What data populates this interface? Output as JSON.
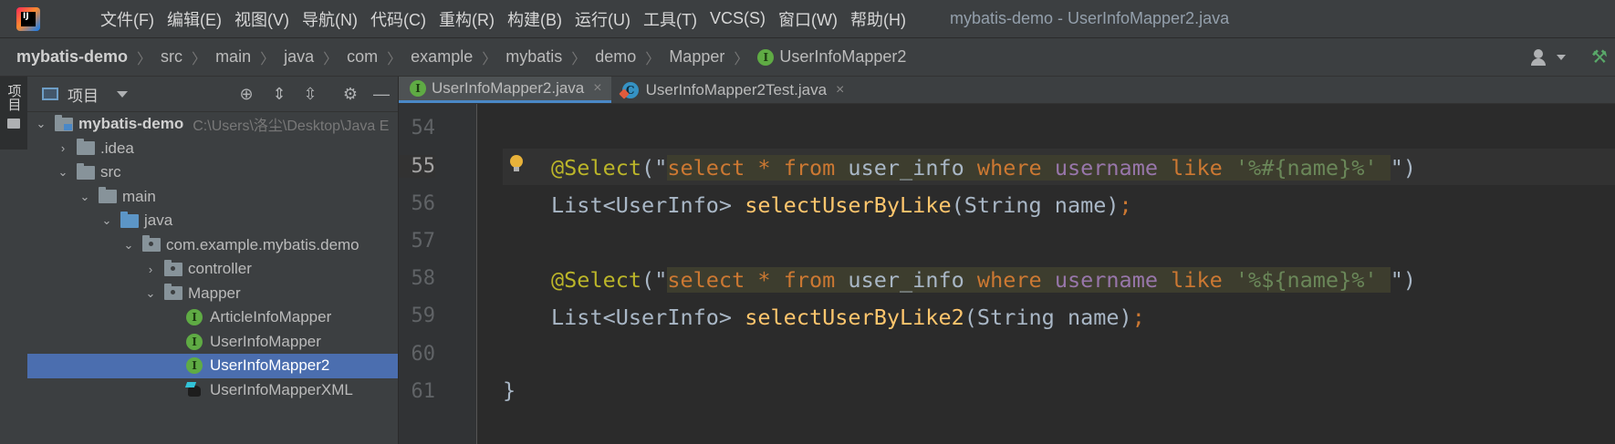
{
  "menu": {
    "items": [
      "文件(F)",
      "编辑(E)",
      "视图(V)",
      "导航(N)",
      "代码(C)",
      "重构(R)",
      "构建(B)",
      "运行(U)",
      "工具(T)",
      "VCS(S)",
      "窗口(W)",
      "帮助(H)"
    ],
    "window_title": "mybatis-demo - UserInfoMapper2.java"
  },
  "breadcrumb": [
    "mybatis-demo",
    "src",
    "main",
    "java",
    "com",
    "example",
    "mybatis",
    "demo",
    "Mapper",
    "UserInfoMapper2"
  ],
  "tool_strip": {
    "project_label": "项目"
  },
  "project_panel": {
    "title": "项目",
    "tree": [
      {
        "label": "mybatis-demo",
        "hint": "C:\\Users\\洛尘\\Desktop\\Java E",
        "icon": "project-folder-icon",
        "level": 0,
        "expanded": true
      },
      {
        "label": ".idea",
        "icon": "folder-icon",
        "level": 1,
        "expanded": false
      },
      {
        "label": "src",
        "icon": "folder-icon",
        "level": 1,
        "expanded": true
      },
      {
        "label": "main",
        "icon": "folder-icon",
        "level": 2,
        "expanded": true
      },
      {
        "label": "java",
        "icon": "source-folder-icon",
        "level": 3,
        "expanded": true
      },
      {
        "label": "com.example.mybatis.demo",
        "icon": "package-icon",
        "level": 4,
        "expanded": true
      },
      {
        "label": "controller",
        "icon": "package-icon",
        "level": 5,
        "expanded": false
      },
      {
        "label": "Mapper",
        "icon": "package-icon",
        "level": 5,
        "expanded": true
      },
      {
        "label": "ArticleInfoMapper",
        "icon": "interface-icon",
        "level": 6
      },
      {
        "label": "UserInfoMapper",
        "icon": "interface-icon",
        "level": 6
      },
      {
        "label": "UserInfoMapper2",
        "icon": "interface-icon",
        "level": 6,
        "selected": true
      },
      {
        "label": "UserInfoMapperXML",
        "icon": "mybatis-xml-icon",
        "level": 6
      }
    ]
  },
  "editor": {
    "tabs": [
      {
        "label": "UserInfoMapper2.java",
        "icon": "interface-icon",
        "active": true
      },
      {
        "label": "UserInfoMapper2Test.java",
        "icon": "test-class-icon",
        "active": false
      }
    ],
    "line_numbers": [
      "54",
      "55",
      "56",
      "57",
      "58",
      "59",
      "60",
      "61"
    ],
    "current_line": "55",
    "code": {
      "line55": {
        "annotation": "@Select",
        "open": "(\"",
        "sql_select": "select",
        "sql_star": " * ",
        "sql_from": "from",
        "sql_table": " user_info ",
        "sql_where": "where",
        "sql_col": " username ",
        "sql_like": "like",
        "sql_value": " '%#{name}%' ",
        "close": "\")"
      },
      "line56": {
        "type": "List<UserInfo> ",
        "method": "selectUserByLike",
        "params": "(String name)",
        "semi": ";"
      },
      "line58": {
        "annotation": "@Select",
        "open": "(\"",
        "sql_select": "select",
        "sql_star": " * ",
        "sql_from": "from",
        "sql_table": " user_info ",
        "sql_where": "where",
        "sql_col": " username ",
        "sql_like": "like",
        "sql_value": " '%${name}%' ",
        "close": "\")"
      },
      "line59": {
        "type": "List<UserInfo> ",
        "method": "selectUserByLike2",
        "params": "(String name)",
        "semi": ";"
      },
      "line61": "}"
    }
  },
  "colors": {
    "accent": "#4a88c7",
    "selection": "#4b6eaf",
    "annotation": "#bbb529",
    "keyword": "#cc7832",
    "string": "#6a8759",
    "method": "#ffc66d"
  }
}
